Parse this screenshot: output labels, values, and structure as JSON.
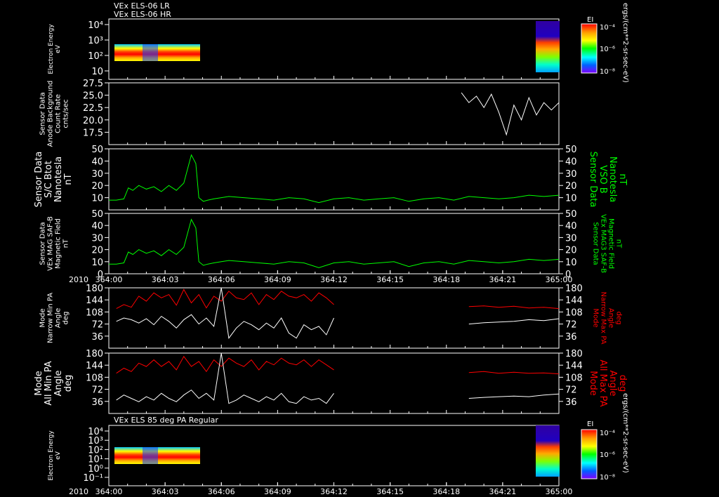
{
  "header": {
    "line1": "VEx ELS-06 LR",
    "line2": "VEx ELS-06 HR",
    "bottom_panel_title": "VEx ELS 85 deg PA Regular"
  },
  "colorbar": {
    "label": "EI",
    "units": "ergs/(cm**2-sr-sec-eV)",
    "ticks": [
      "10⁻⁴",
      "10⁻⁶",
      "10⁻⁸"
    ]
  },
  "colors": {
    "green": "#00ff00",
    "red": "#ff0000",
    "white": "#ffffff"
  },
  "chart_data": [
    {
      "type": "heatmap",
      "ylabel": [
        "Electron Energy",
        "eV"
      ],
      "yticks": [
        "10⁴",
        "10³",
        "10²",
        "10"
      ],
      "time_ranges": [
        [
          "364:00",
          "364:04.5"
        ],
        [
          "364:22.5",
          "365:00"
        ]
      ]
    },
    {
      "type": "line",
      "ylabel": [
        "Sensor Data",
        "Anode Background",
        "Count Rate",
        "cnts/sec"
      ],
      "ylim": [
        15,
        27.5
      ],
      "yticks": [
        "27.5",
        "25.0",
        "22.5",
        "20.0",
        "17.5"
      ],
      "series": [
        {
          "color": "#ffffff",
          "x": [
            364.235,
            364.24,
            364.245,
            364.25,
            364.255,
            364.26,
            364.265,
            364.27,
            364.275,
            364.28,
            364.285,
            364.29,
            364.295,
            364.3
          ],
          "y": [
            25.5,
            23.5,
            24.8,
            22.5,
            25.2,
            21.5,
            17.0,
            23.0,
            20.0,
            24.5,
            21.0,
            23.5,
            22.0,
            23.5
          ]
        }
      ]
    },
    {
      "type": "line",
      "ylabel": [
        "Sensor Data",
        "S/C Btot",
        "Nanotesla",
        "nT"
      ],
      "ylabel_right": [
        "Sensor Data",
        "VSO B",
        "Nanotesla",
        "nT"
      ],
      "ylim": [
        0,
        50
      ],
      "yticks": [
        "50",
        "40",
        "30",
        "20",
        "10"
      ],
      "series": [
        {
          "color": "#00ff00",
          "x": [
            364.0,
            364.005,
            364.01,
            364.013,
            364.016,
            364.02,
            364.025,
            364.03,
            364.035,
            364.04,
            364.045,
            364.05,
            364.055,
            364.058,
            364.06,
            364.063,
            364.066,
            364.07,
            364.075,
            364.08,
            364.09,
            364.1,
            364.11,
            364.12,
            364.13,
            364.14,
            364.15,
            364.16,
            364.17,
            364.18,
            364.19,
            364.2,
            364.21,
            364.22,
            364.23,
            364.24,
            364.25,
            364.26,
            364.27,
            364.28,
            364.29,
            364.3
          ],
          "y": [
            8,
            8,
            9,
            18,
            16,
            20,
            17,
            19,
            15,
            20,
            16,
            22,
            45,
            38,
            10,
            7,
            8,
            9,
            10,
            11,
            10,
            9,
            8,
            10,
            9,
            6,
            9,
            10,
            8,
            9,
            10,
            7,
            9,
            10,
            8,
            11,
            10,
            9,
            10,
            12,
            11,
            12
          ]
        }
      ]
    },
    {
      "type": "line",
      "ylabel": [
        "Sensor Data",
        "VEx MAG SAF-B",
        "Magnetic Field",
        "nT"
      ],
      "ylabel_right": [
        "Sensor Data",
        "VEx MAG3 SAF-B",
        "Magnetic Field",
        "nT"
      ],
      "ylim": [
        0,
        50
      ],
      "yticks": [
        "50",
        "40",
        "30",
        "20",
        "10",
        "0"
      ],
      "series": [
        {
          "color": "#00ff00",
          "x": [
            364.0,
            364.005,
            364.01,
            364.013,
            364.016,
            364.02,
            364.025,
            364.03,
            364.035,
            364.04,
            364.045,
            364.05,
            364.055,
            364.058,
            364.06,
            364.063,
            364.066,
            364.07,
            364.075,
            364.08,
            364.09,
            364.1,
            364.11,
            364.12,
            364.13,
            364.14,
            364.15,
            364.16,
            364.17,
            364.18,
            364.19,
            364.2,
            364.21,
            364.22,
            364.23,
            364.24,
            364.25,
            364.26,
            364.27,
            364.28,
            364.29,
            364.3
          ],
          "y": [
            8,
            8,
            9,
            18,
            16,
            20,
            17,
            19,
            15,
            20,
            16,
            22,
            45,
            38,
            10,
            7,
            8,
            9,
            10,
            11,
            10,
            9,
            8,
            10,
            9,
            5,
            9,
            10,
            8,
            9,
            10,
            6,
            9,
            10,
            8,
            11,
            10,
            9,
            10,
            12,
            11,
            12
          ]
        }
      ]
    },
    {
      "type": "line",
      "ylabel": [
        "Mode",
        "Narrow Min PA",
        "Angle",
        "deg"
      ],
      "ylabel_right": [
        "Mode",
        "Narrow Max PA",
        "Angle",
        "deg"
      ],
      "ylim": [
        0,
        180
      ],
      "yticks": [
        "180",
        "144",
        "108",
        "72",
        "36"
      ],
      "series": [
        {
          "color": "#ff0000",
          "x": [
            364.005,
            364.01,
            364.015,
            364.02,
            364.025,
            364.03,
            364.035,
            364.04,
            364.045,
            364.05,
            364.055,
            364.06,
            364.065,
            364.07,
            364.075,
            364.08,
            364.085,
            364.09,
            364.095,
            364.1,
            364.105,
            364.11,
            364.115,
            364.12,
            364.125,
            364.13,
            364.135,
            364.14,
            364.145,
            364.15
          ],
          "y": [
            118,
            130,
            122,
            155,
            140,
            165,
            150,
            160,
            128,
            175,
            135,
            160,
            120,
            155,
            140,
            170,
            150,
            145,
            165,
            130,
            160,
            145,
            170,
            155,
            150,
            160,
            140,
            165,
            150,
            130
          ]
        },
        {
          "color": "#ffffff",
          "x": [
            364.005,
            364.01,
            364.015,
            364.02,
            364.025,
            364.03,
            364.035,
            364.04,
            364.045,
            364.05,
            364.055,
            364.06,
            364.065,
            364.07,
            364.075,
            364.08,
            364.085,
            364.09,
            364.095,
            364.1,
            364.105,
            364.11,
            364.115,
            364.12,
            364.125,
            364.13,
            364.135,
            364.14,
            364.145,
            364.15
          ],
          "y": [
            80,
            90,
            85,
            75,
            88,
            70,
            95,
            80,
            60,
            85,
            100,
            72,
            90,
            65,
            180,
            30,
            60,
            80,
            70,
            55,
            75,
            60,
            90,
            45,
            30,
            70,
            55,
            65,
            40,
            90
          ]
        },
        {
          "color": "#ff0000",
          "x": [
            364.24,
            364.25,
            364.26,
            364.27,
            364.28,
            364.29,
            364.3
          ],
          "y": [
            124,
            126,
            122,
            125,
            120,
            122,
            118
          ]
        },
        {
          "color": "#ffffff",
          "x": [
            364.24,
            364.25,
            364.26,
            364.27,
            364.28,
            364.29,
            364.3
          ],
          "y": [
            72,
            76,
            78,
            80,
            85,
            82,
            88
          ]
        }
      ]
    },
    {
      "type": "line",
      "ylabel": [
        "Mode",
        "All Min PA",
        "Angle",
        "deg"
      ],
      "ylabel_right": [
        "Mode",
        "All Max PA",
        "Angle",
        "deg"
      ],
      "ylim": [
        0,
        180
      ],
      "yticks": [
        "180",
        "144",
        "108",
        "72",
        "36"
      ],
      "series": [
        {
          "color": "#ff0000",
          "x": [
            364.005,
            364.01,
            364.015,
            364.02,
            364.025,
            364.03,
            364.035,
            364.04,
            364.045,
            364.05,
            364.055,
            364.06,
            364.065,
            364.07,
            364.075,
            364.08,
            364.085,
            364.09,
            364.095,
            364.1,
            364.105,
            364.11,
            364.115,
            364.12,
            364.125,
            364.13,
            364.135,
            364.14,
            364.145,
            364.15
          ],
          "y": [
            120,
            135,
            125,
            150,
            140,
            160,
            140,
            155,
            130,
            170,
            140,
            155,
            125,
            160,
            140,
            165,
            150,
            140,
            160,
            130,
            155,
            145,
            165,
            150,
            145,
            160,
            140,
            160,
            145,
            130
          ]
        },
        {
          "color": "#ffffff",
          "x": [
            364.005,
            364.01,
            364.015,
            364.02,
            364.025,
            364.03,
            364.035,
            364.04,
            364.045,
            364.05,
            364.055,
            364.06,
            364.065,
            364.07,
            364.075,
            364.08,
            364.085,
            364.09,
            364.095,
            364.1,
            364.105,
            364.11,
            364.115,
            364.12,
            364.125,
            364.13,
            364.135,
            364.14,
            364.145,
            364.15
          ],
          "y": [
            40,
            55,
            45,
            35,
            50,
            40,
            60,
            45,
            35,
            55,
            70,
            45,
            60,
            40,
            180,
            30,
            40,
            55,
            45,
            35,
            50,
            40,
            60,
            35,
            30,
            50,
            40,
            45,
            30,
            60
          ]
        },
        {
          "color": "#ff0000",
          "x": [
            364.24,
            364.25,
            364.26,
            364.27,
            364.28,
            364.29,
            364.3
          ],
          "y": [
            122,
            125,
            120,
            123,
            120,
            121,
            118
          ]
        },
        {
          "color": "#ffffff",
          "x": [
            364.24,
            364.25,
            364.26,
            364.27,
            364.28,
            364.29,
            364.3
          ],
          "y": [
            45,
            48,
            50,
            52,
            50,
            55,
            58
          ]
        }
      ]
    },
    {
      "type": "heatmap",
      "ylabel": [
        "Electron Energy",
        "eV"
      ],
      "yticks": [
        "10⁴",
        "10³",
        "10²",
        "10¹",
        "10⁰",
        "10⁻¹"
      ],
      "time_ranges": [
        [
          "364:00",
          "364:04.5"
        ],
        [
          "364:22.5",
          "365:00"
        ]
      ]
    }
  ],
  "time_axis": {
    "year": "2010",
    "xlim": [
      364.0,
      364.3
    ],
    "ticks": [
      "364:00",
      "364:03",
      "364:06",
      "364:09",
      "364:12",
      "364:15",
      "364:18",
      "364:21",
      "365:00"
    ]
  }
}
